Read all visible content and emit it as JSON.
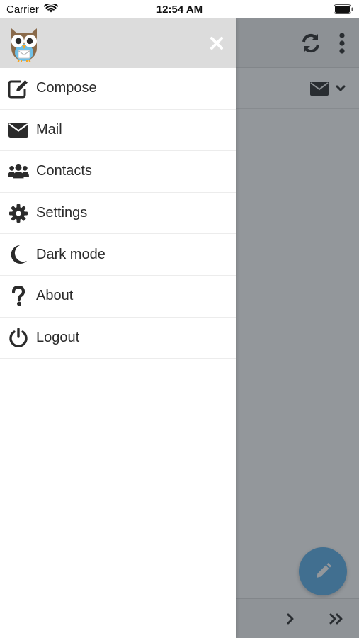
{
  "status_bar": {
    "carrier": "Carrier",
    "time": "12:54 AM"
  },
  "drawer": {
    "close_icon": "✕",
    "items": [
      {
        "label": "Compose",
        "icon": "edit-icon"
      },
      {
        "label": "Mail",
        "icon": "envelope-icon"
      },
      {
        "label": "Contacts",
        "icon": "users-icon"
      },
      {
        "label": "Settings",
        "icon": "gear-icon"
      },
      {
        "label": "Dark mode",
        "icon": "moon-icon"
      },
      {
        "label": "About",
        "icon": "question-icon"
      },
      {
        "label": "Logout",
        "icon": "power-icon"
      }
    ]
  },
  "colors": {
    "drawer_header": "#dcdcdc",
    "fab": "#5aaee8",
    "icon": "#2b2b2b"
  }
}
